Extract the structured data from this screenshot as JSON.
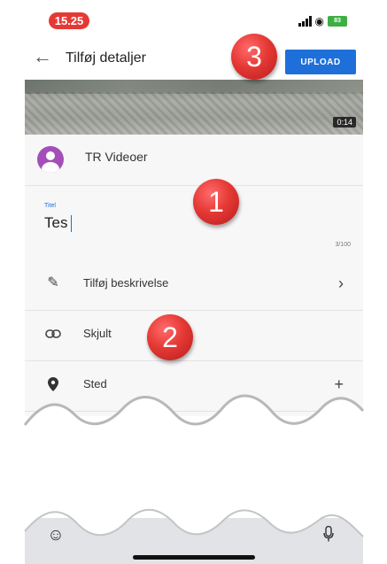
{
  "status_bar": {
    "time": "15.25",
    "battery": "83"
  },
  "header": {
    "title": "Tilføj detaljer",
    "upload_label": "UPLOAD"
  },
  "video": {
    "duration": "0:14"
  },
  "channel": {
    "name": "TR Videoer"
  },
  "title_field": {
    "label": "Titel",
    "value": "Tes",
    "counter": "3/100"
  },
  "rows": [
    {
      "label": "Tilføj beskrivelse",
      "icon": "pencil-icon",
      "trailing": "›"
    },
    {
      "label": "Skjult",
      "icon": "link-icon",
      "trailing": ""
    },
    {
      "label": "Sted",
      "icon": "location-pin-icon",
      "trailing": "+"
    }
  ],
  "markers": [
    "1",
    "2",
    "3"
  ],
  "colors": {
    "accent": "#1e6fd9",
    "marker": "#e53935",
    "time_pill": "#e53935",
    "avatar": "#a44fb8"
  }
}
